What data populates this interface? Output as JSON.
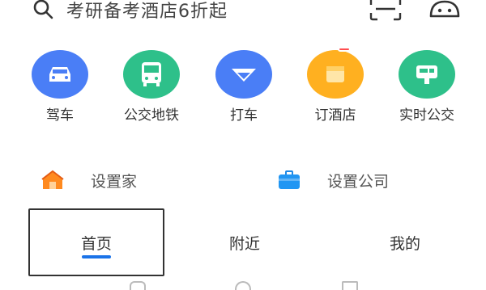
{
  "search": {
    "placeholder": "考研备考酒店6折起"
  },
  "services": [
    {
      "label": "驾车",
      "icon": "car-icon",
      "color": "#4a7ef6"
    },
    {
      "label": "公交地铁",
      "icon": "bus-icon",
      "color": "#2ec08a"
    },
    {
      "label": "打车",
      "icon": "taxi-icon",
      "color": "#4a7ef6"
    },
    {
      "label": "订酒店",
      "icon": "hotel-icon",
      "color": "#ffb020",
      "badge": ""
    },
    {
      "label": "实时公交",
      "icon": "realtime-bus-icon",
      "color": "#2ec08a"
    }
  ],
  "shortcuts": {
    "home_label": "设置家",
    "company_label": "设置公司"
  },
  "tabs": [
    {
      "label": "首页",
      "active": true
    },
    {
      "label": "附近",
      "active": false
    },
    {
      "label": "我的",
      "active": false
    }
  ]
}
